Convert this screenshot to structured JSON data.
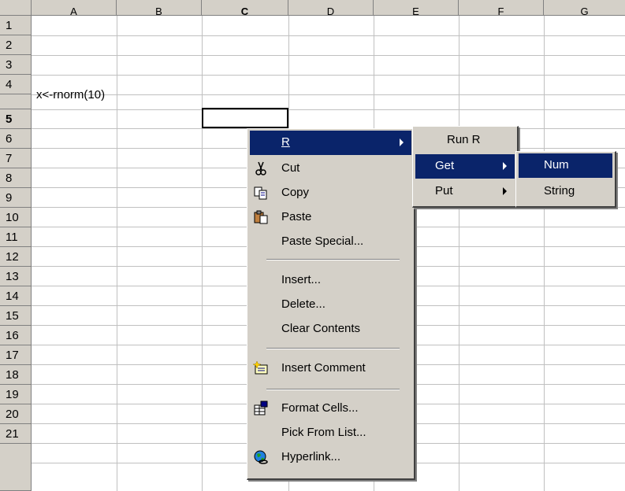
{
  "sheet": {
    "column_headers": [
      "A",
      "B",
      "C",
      "D",
      "E",
      "F",
      "G"
    ],
    "row_headers": [
      "1",
      "2",
      "3",
      "4",
      "5",
      "6",
      "7",
      "8",
      "9",
      "10",
      "11",
      "12",
      "13",
      "14",
      "15",
      "16",
      "17",
      "18",
      "19",
      "20",
      "21"
    ],
    "cell_A4": "x<-rnorm(10)"
  },
  "context_menu": {
    "items": [
      {
        "label": "R",
        "submenu": true
      },
      {
        "label": "Cut",
        "icon": "scissors-icon"
      },
      {
        "label": "Copy",
        "icon": "copy-icon"
      },
      {
        "label": "Paste",
        "icon": "paste-icon"
      },
      {
        "label": "Paste Special..."
      },
      {
        "label": "Insert..."
      },
      {
        "label": "Delete..."
      },
      {
        "label": "Clear Contents"
      },
      {
        "label": "Insert Comment",
        "icon": "comment-icon"
      },
      {
        "label": "Format Cells...",
        "icon": "format-cells-icon"
      },
      {
        "label": "Pick From List..."
      },
      {
        "label": "Hyperlink...",
        "icon": "hyperlink-icon"
      }
    ]
  },
  "r_submenu": {
    "items": [
      {
        "label": "Run R"
      },
      {
        "label": "Get",
        "submenu": true
      },
      {
        "label": "Put",
        "submenu": true
      }
    ]
  },
  "get_submenu": {
    "items": [
      {
        "label": "Num"
      },
      {
        "label": "String"
      }
    ]
  },
  "colors": {
    "menu_bg": "#d4d0c8",
    "highlight": "#0a246a",
    "grid": "#c0c0c0"
  }
}
